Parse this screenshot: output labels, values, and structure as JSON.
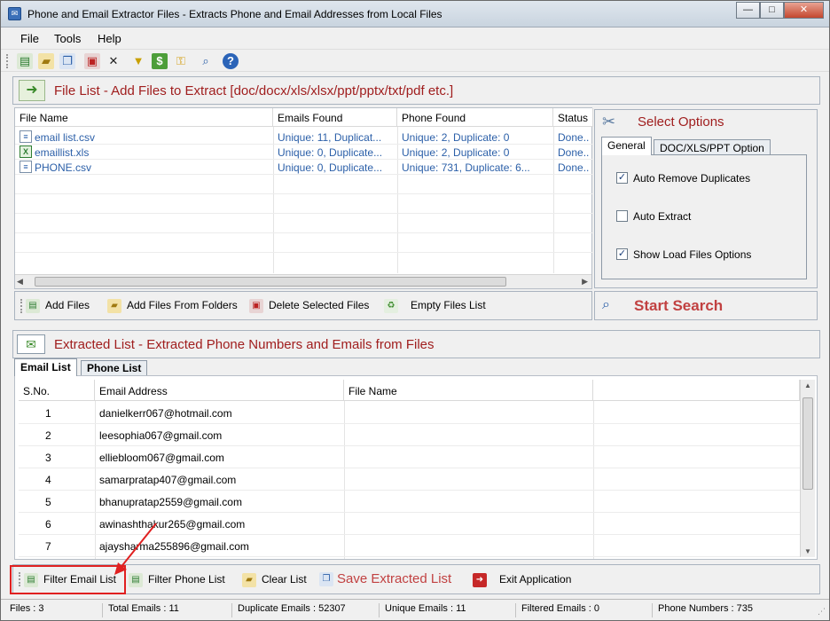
{
  "window": {
    "title": "Phone and Email Extractor Files  -  Extracts Phone and Email Addresses from Local Files",
    "min_label": "—",
    "max_label": "□",
    "close_label": "✕"
  },
  "menu": {
    "items": [
      "File",
      "Tools",
      "Help"
    ]
  },
  "toolbar": {
    "icons": [
      "add-files-icon",
      "add-folder-icon",
      "copy-icon",
      "delete-icon",
      "close-icon",
      "filter-icon",
      "dollar-icon",
      "key-icon",
      "search-icon",
      "help-icon"
    ]
  },
  "file_list": {
    "heading": "File List - Add Files to Extract  [doc/docx/xls/xlsx/ppt/pptx/txt/pdf etc.]",
    "columns": [
      "File Name",
      "Emails Found",
      "Phone Found",
      "Status"
    ],
    "rows": [
      {
        "name": "email list.csv",
        "emails": "Unique: 11, Duplicat...",
        "phones": "Unique: 2, Duplicate: 0",
        "status": "Done..",
        "icon": "csv-file-icon"
      },
      {
        "name": "emaillist.xls",
        "emails": "Unique: 0, Duplicate...",
        "phones": "Unique: 2, Duplicate: 0",
        "status": "Done..",
        "icon": "excel-file-icon"
      },
      {
        "name": "PHONE.csv",
        "emails": "Unique: 0, Duplicate...",
        "phones": "Unique: 731, Duplicate: 6...",
        "status": "Done..",
        "icon": "csv-file-icon"
      }
    ],
    "buttons": [
      "Add Files",
      "Add Files From Folders",
      "Delete Selected Files",
      "Empty Files List"
    ]
  },
  "options": {
    "heading": "Select Options",
    "tabs": [
      "General",
      "DOC/XLS/PPT Option"
    ],
    "checks": [
      {
        "label": "Auto Remove Duplicates",
        "checked": true
      },
      {
        "label": "Auto Extract",
        "checked": false
      },
      {
        "label": "Show Load Files Options",
        "checked": true
      }
    ],
    "start_label": "Start Search"
  },
  "extracted": {
    "heading": "Extracted List - Extracted Phone Numbers and Emails from Files",
    "tabs": [
      "Email List",
      "Phone List"
    ],
    "columns": [
      "S.No.",
      "Email Address",
      "File Name"
    ],
    "rows": [
      {
        "no": "1",
        "email": "danielkerr067@hotmail.com"
      },
      {
        "no": "2",
        "email": "leesophia067@gmail.com"
      },
      {
        "no": "3",
        "email": "elliebloom067@gmail.com"
      },
      {
        "no": "4",
        "email": "samarpratap407@gmail.com"
      },
      {
        "no": "5",
        "email": "bhanupratap2559@gmail.com"
      },
      {
        "no": "6",
        "email": "awinashthakur265@gmail.com"
      },
      {
        "no": "7",
        "email": "ajaysharma255896@gmail.com"
      }
    ],
    "buttons": {
      "filter_email": "Filter Email List",
      "filter_phone": "Filter Phone List",
      "clear": "Clear List",
      "save": "Save Extracted List",
      "exit": "Exit Application"
    }
  },
  "status": {
    "files": "Files :  3",
    "total_emails": "Total Emails :  11",
    "duplicate_emails": "Duplicate Emails :  52307",
    "unique_emails": "Unique Emails :  11",
    "filtered_emails": "Filtered Emails :  0",
    "phone_numbers": "Phone Numbers :  735"
  },
  "colors": {
    "accent_red": "#a01e1e",
    "link_blue": "#2b5fa8",
    "annotation_red": "#e02020"
  }
}
